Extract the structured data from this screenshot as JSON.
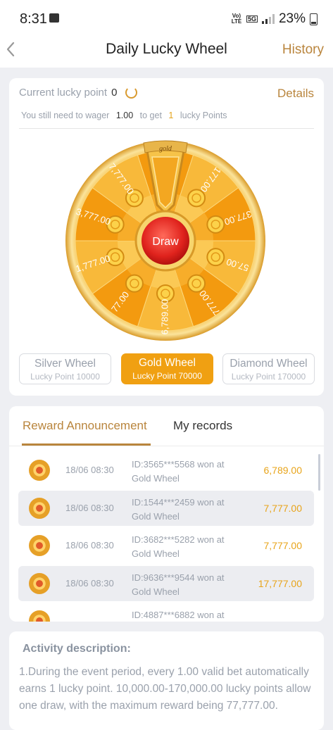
{
  "status": {
    "time": "8:31",
    "net_small": "Vo) LTE",
    "net_5g": "5G",
    "battery": "23%"
  },
  "header": {
    "title": "Daily Lucky Wheel",
    "history": "History"
  },
  "lucky": {
    "label": "Current lucky point",
    "value": "0",
    "details": "Details",
    "wager_pre": "You still need to wager",
    "wager_amount": "1.00",
    "wager_mid": "to get",
    "wager_points": "1",
    "wager_post": "lucky Points"
  },
  "wheel": {
    "pointer_label": "gold",
    "draw": "Draw",
    "segments": [
      "7,777.00",
      "177.00",
      "377.00",
      "57.00",
      "777.00",
      "6,789.00",
      "77.00",
      "1,777.00",
      "3,777.00",
      "7,777.00"
    ]
  },
  "wheel_tabs": [
    {
      "name": "Silver Wheel",
      "sub": "Lucky Point 10000"
    },
    {
      "name": "Gold Wheel",
      "sub": "Lucky Point 70000"
    },
    {
      "name": "Diamond Wheel",
      "sub": "Lucky Point 170000"
    }
  ],
  "records_tabs": {
    "announcement": "Reward Announcement",
    "my_records": "My records"
  },
  "rewards": [
    {
      "date": "18/06 08:30",
      "text": "ID:3565***5568 won at Gold Wheel",
      "amount": "6,789.00"
    },
    {
      "date": "18/06 08:30",
      "text": "ID:1544***2459 won at Gold Wheel",
      "amount": "7,777.00"
    },
    {
      "date": "18/06 08:30",
      "text": "ID:3682***5282 won at Gold Wheel",
      "amount": "7,777.00"
    },
    {
      "date": "18/06 08:30",
      "text": "ID:9636***9544 won at Gold Wheel",
      "amount": "17,777.00"
    },
    {
      "date": "",
      "text": "ID:4887***6882 won at",
      "amount": ""
    }
  ],
  "activity": {
    "title": "Activity description:",
    "text": "1.During the event period, every 1.00 valid bet automatically earns 1 lucky point. 10,000.00-170,000.00 lucky points allow one draw, with the maximum reward being 77,777.00."
  }
}
